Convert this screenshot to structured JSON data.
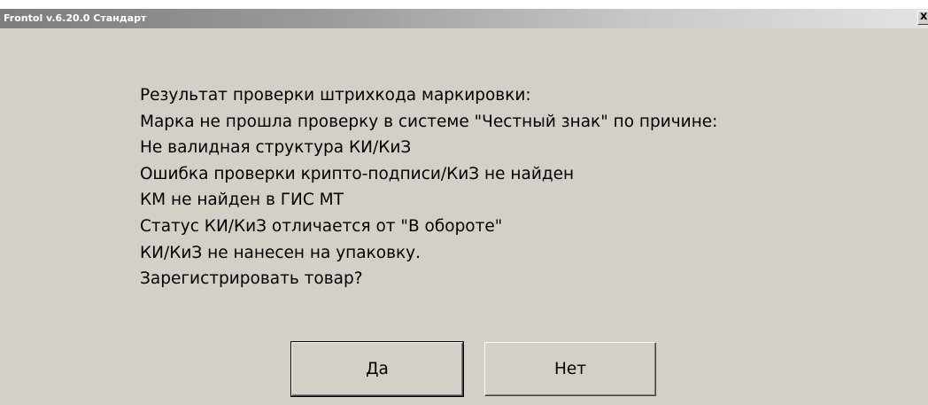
{
  "window": {
    "title": "Frontol v.6.20.0 Стандарт",
    "close_symbol": "x"
  },
  "message": {
    "lines": [
      "Результат проверки штрихкода маркировки:",
      "Марка не прошла проверку в системе \"Честный знак\" по причине:",
      "Не валидная структура КИ/КиЗ",
      "Ошибка проверки крипто-подписи/КиЗ не найден",
      "КМ не найден в ГИС МТ",
      "Статус КИ/КиЗ отличается от \"В обороте\"",
      "КИ/КиЗ не нанесен на упаковку.",
      "Зарегистрировать товар?"
    ]
  },
  "buttons": {
    "yes_label": "Да",
    "no_label": "Нет"
  },
  "colors": {
    "background": "#d4d0c8",
    "title_text": "#ffffff",
    "text": "#000000"
  }
}
